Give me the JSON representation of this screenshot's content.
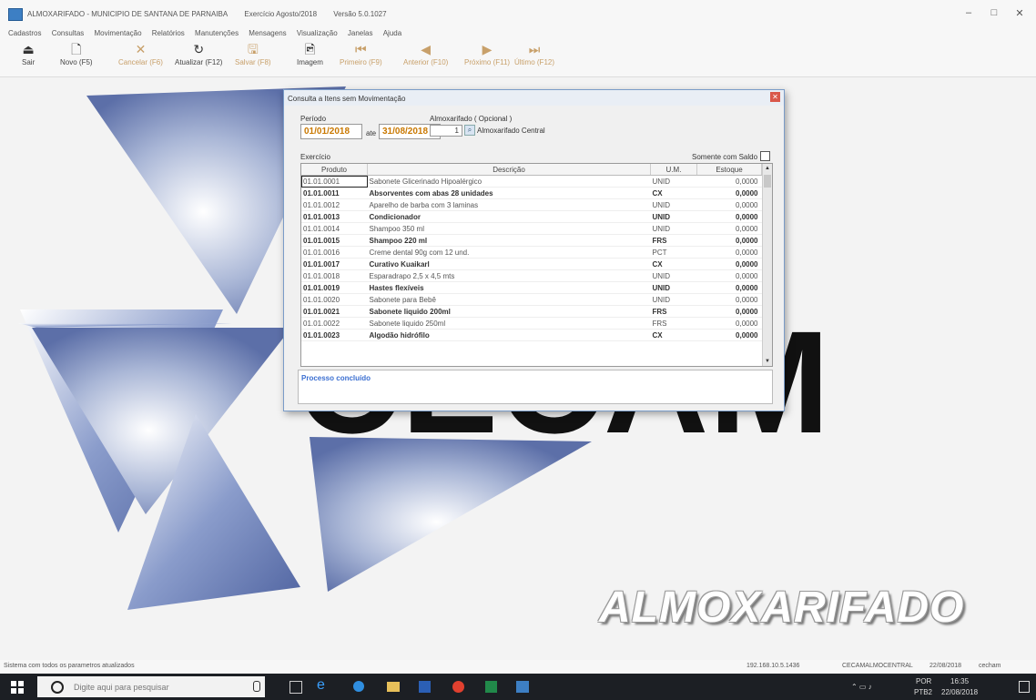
{
  "window": {
    "title": "ALMOXARIFADO - MUNICIPIO DE SANTANA DE PARNAIBA",
    "exercise": "Exercício Agosto/2018",
    "version": "Versão 5.0.1027",
    "controls": {
      "minimize": "–",
      "maximize": "□",
      "close": "✕"
    }
  },
  "menu": [
    "Cadastros",
    "Consultas",
    "Movimentação",
    "Relatórios",
    "Manutenções",
    "Mensagens",
    "Visualização",
    "Janelas",
    "Ajuda"
  ],
  "toolbar": [
    {
      "label": "Sair",
      "icon": "exit-icon",
      "glyph": "⏏",
      "enabled": true
    },
    {
      "label": "Novo (F5)",
      "icon": "new-document-icon",
      "glyph": "🗋",
      "enabled": true
    },
    {
      "label": "Cancelar (F6)",
      "icon": "cancel-icon",
      "glyph": "✕",
      "enabled": false
    },
    {
      "label": "Atualizar (F12)",
      "icon": "refresh-icon",
      "glyph": "↻",
      "enabled": true
    },
    {
      "label": "Salvar (F8)",
      "icon": "save-icon",
      "glyph": "🖫",
      "enabled": false
    },
    {
      "label": "Imagem",
      "icon": "image-icon",
      "glyph": "🖻",
      "enabled": true
    },
    {
      "label": "Primeiro (F9)",
      "icon": "first-record-icon",
      "glyph": "⏮",
      "enabled": false
    },
    {
      "label": "Anterior (F10)",
      "icon": "previous-record-icon",
      "glyph": "◀",
      "enabled": false
    },
    {
      "label": "Próximo (F11)",
      "icon": "next-record-icon",
      "glyph": "▶",
      "enabled": false
    },
    {
      "label": "Último (F12)",
      "icon": "last-record-icon",
      "glyph": "⏭",
      "enabled": false
    }
  ],
  "dialog": {
    "title": "Consulta a Itens sem Movimentação",
    "close": "✕",
    "period_label": "Período",
    "date_from": "01/01/2018",
    "date_separator": "ate",
    "date_to": "31/08/2018",
    "warehouse_label": "Almoxarifado ( Opcional )",
    "warehouse_code": "1",
    "warehouse_name": "Almoxarifado Central",
    "exercise_label": "Exercício",
    "only_balance_label": "Somente com Saldo",
    "only_balance_checked": false,
    "columns": [
      "Produto",
      "Descrição",
      "U.M.",
      "Estoque"
    ],
    "rows": [
      {
        "code": "01.01.0001",
        "desc": "Sabonete Glicerinado Hipoalérgico",
        "um": "UNID",
        "stock": "0,0000",
        "bold": false
      },
      {
        "code": "01.01.0011",
        "desc": "Absorventes com abas 28 unidades",
        "um": "CX",
        "stock": "0,0000",
        "bold": true
      },
      {
        "code": "01.01.0012",
        "desc": "Aparelho de barba com 3 laminas",
        "um": "UNID",
        "stock": "0,0000",
        "bold": false
      },
      {
        "code": "01.01.0013",
        "desc": "Condicionador",
        "um": "UNID",
        "stock": "0,0000",
        "bold": true
      },
      {
        "code": "01.01.0014",
        "desc": "Shampoo 350 ml",
        "um": "UNID",
        "stock": "0,0000",
        "bold": false
      },
      {
        "code": "01.01.0015",
        "desc": "Shampoo 220 ml",
        "um": "FRS",
        "stock": "0,0000",
        "bold": true
      },
      {
        "code": "01.01.0016",
        "desc": "Creme dental 90g com 12 und.",
        "um": "PCT",
        "stock": "0,0000",
        "bold": false
      },
      {
        "code": "01.01.0017",
        "desc": "Curativo Kuaikarl",
        "um": "CX",
        "stock": "0,0000",
        "bold": true
      },
      {
        "code": "01.01.0018",
        "desc": "Esparadrapo 2,5 x 4,5 mts",
        "um": "UNID",
        "stock": "0,0000",
        "bold": false
      },
      {
        "code": "01.01.0019",
        "desc": "Hastes flexíveis",
        "um": "UNID",
        "stock": "0,0000",
        "bold": true
      },
      {
        "code": "01.01.0020",
        "desc": "Sabonete para Bebê",
        "um": "UNID",
        "stock": "0,0000",
        "bold": false
      },
      {
        "code": "01.01.0021",
        "desc": "Sabonete liquido 200ml",
        "um": "FRS",
        "stock": "0,0000",
        "bold": true
      },
      {
        "code": "01.01.0022",
        "desc": "Sabonete liquido 250ml",
        "um": "FRS",
        "stock": "0,0000",
        "bold": false
      },
      {
        "code": "01.01.0023",
        "desc": "Algodão hidrófilo",
        "um": "CX",
        "stock": "0,0000",
        "bold": true
      }
    ],
    "status_message": "Processo concluído"
  },
  "background": {
    "logo_word": "ALMOXARIFADO",
    "logo_letters": "CECAM"
  },
  "status_bar": {
    "message": "Sistema com todos os parametros atualizados",
    "ip": "192.168.10.5.1436",
    "server": "CECAMALMOCENTRAL",
    "date": "22/08/2018",
    "user": "cecham"
  },
  "taskbar": {
    "search_placeholder": "Digite aqui para pesquisar",
    "language": "POR",
    "keyboard": "PTB2",
    "time": "16:35",
    "date": "22/08/2018"
  },
  "colors": {
    "accent": "#3d7fc4",
    "date_text": "#c97800",
    "status_text": "#3b6fd1",
    "taskbar": "#1c1f24"
  }
}
